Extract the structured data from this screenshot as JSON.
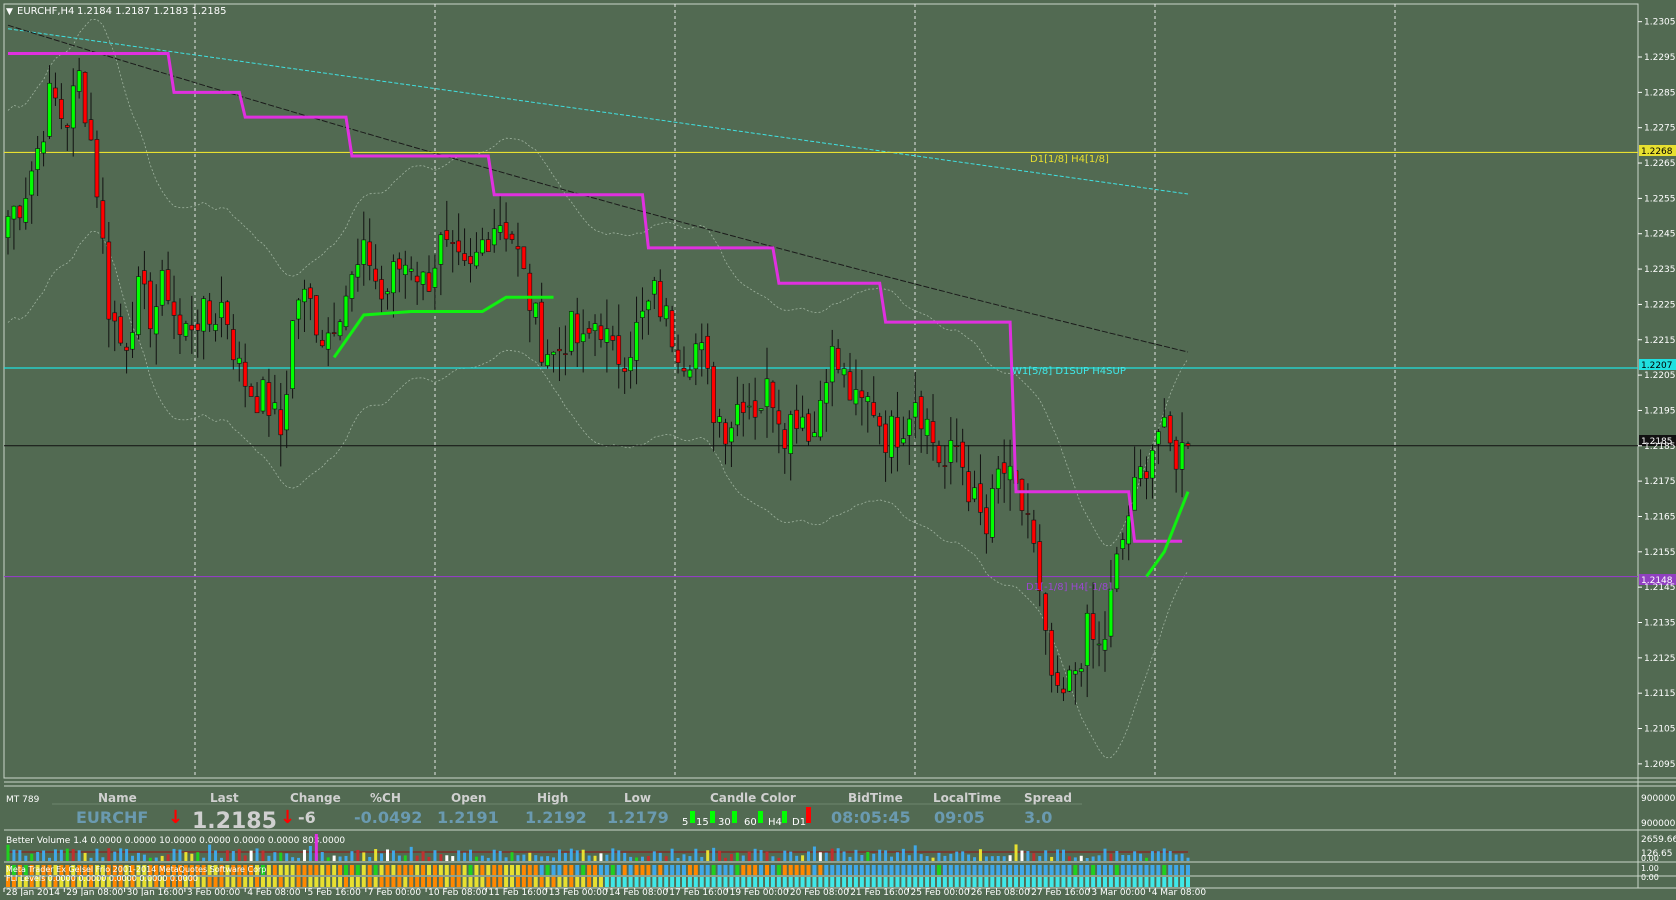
{
  "chart_header": {
    "symbol_tf": "EURCHF,H4",
    "ohlc": "1.2184 1.2187 1.2183 1.2185"
  },
  "colors": {
    "background": "#526a52",
    "bull": "#00ff00",
    "bear": "#ff0000",
    "magenta": "#e030e0",
    "green_line": "#10f010",
    "cyan": "#20e0e0",
    "yellow": "#e8e030",
    "purple": "#9040c0"
  },
  "price_axis": {
    "ticks": [
      "1.2305",
      "1.2295",
      "1.2285",
      "1.2275",
      "1.2265",
      "1.2255",
      "1.2245",
      "1.2235",
      "1.2225",
      "1.2215",
      "1.2205",
      "1.2195",
      "1.2185",
      "1.2175",
      "1.2165",
      "1.2155",
      "1.2145",
      "1.2135",
      "1.2125",
      "1.2115",
      "1.2105",
      "1.2095"
    ],
    "tag_yellow": "1.2268",
    "tag_cyan": "1.2207",
    "tag_black": "1.2185",
    "tag_purple": "1.2148"
  },
  "level_labels": {
    "yellow": "D1[1/8] H4[1/8]",
    "cyan": "W1[5/8] D1SUP H4SUP",
    "purple": "D1[-1/8] H4[-1/8]"
  },
  "time_axis": [
    "28 Jan 2014",
    "29 Jan 08:00",
    "30 Jan 16:00",
    "3 Feb 00:00",
    "4 Feb 08:00",
    "5 Feb 16:00",
    "7 Feb 00:00",
    "10 Feb 08:00",
    "11 Feb 16:00",
    "13 Feb 00:00",
    "14 Feb 08:00",
    "17 Feb 16:00",
    "19 Feb 00:00",
    "20 Feb 08:00",
    "21 Feb 16:00",
    "25 Feb 00:00",
    "26 Feb 08:00",
    "27 Feb 16:00",
    "3 Mar 00:00",
    "4 Mar 08:00"
  ],
  "info_panel": {
    "id": "MT 789",
    "headers": {
      "name": "Name",
      "last": "Last",
      "change": "Change",
      "pct": "%CH",
      "open": "Open",
      "high": "High",
      "low": "Low",
      "candle_color": "Candle Color",
      "bidtime": "BidTime",
      "localtime": "LocalTime",
      "spread": "Spread"
    },
    "values": {
      "name": "EURCHF",
      "last": "1.2185",
      "change": "-6",
      "pct": "-0.0492",
      "open": "1.2191",
      "high": "1.2192",
      "low": "1.2179",
      "bidtime": "08:05:45",
      "localtime": "09:05",
      "spread": "3.0"
    },
    "tf_labels": [
      "5",
      "15",
      "30",
      "60",
      "H4",
      "D1"
    ],
    "axis_top": "9000000",
    "axis_bottom": "9000000"
  },
  "volume_panel": {
    "label": "Better Volume 1.4 0.0000 0.0000 10.0000 0.0000 0.0000 0.0000 803.0000",
    "ticks": [
      "2659.66",
      "126.65",
      "0.00"
    ]
  },
  "bottom_strip": {
    "label1": "Meta Trader Ex Gelsel Frio 2001-2014 MetaQuotes Software Corp",
    "label2": "FLI Levels 0.0000 0.0000 0.0000 0.0000 0.0000",
    "ticks": [
      "1.00",
      "0.00"
    ]
  },
  "chart_data": {
    "type": "candlestick",
    "symbol": "EURCHF",
    "timeframe": "H4",
    "ylim": [
      1.2091,
      1.231
    ],
    "period_first": "28 Jan 2014",
    "period_last": "4 Mar 08:00",
    "last_price": 1.2185,
    "levels": [
      {
        "label": "D1[1/8] H4[1/8]",
        "value": 1.2268
      },
      {
        "label": "W1[5/8] D1SUP H4SUP",
        "value": 1.2207
      },
      {
        "label": "D1[-1/8] H4[-1/8]",
        "value": 1.2148
      }
    ],
    "path_anchors": [
      1.225,
      1.2255,
      1.2268,
      1.2285,
      1.2276,
      1.229,
      1.2266,
      1.2225,
      1.2212,
      1.2228,
      1.2222,
      1.2232,
      1.2215,
      1.2222,
      1.222,
      1.2226,
      1.2207,
      1.22,
      1.2198,
      1.2188,
      1.2228,
      1.2225,
      1.2215,
      1.2225,
      1.2232,
      1.224,
      1.2226,
      1.2235,
      1.2238,
      1.223,
      1.2242,
      1.2236,
      1.2232,
      1.2243,
      1.225,
      1.2245,
      1.223,
      1.2215,
      1.221,
      1.2218,
      1.2212,
      1.2222,
      1.221,
      1.2212,
      1.222,
      1.2228,
      1.2218,
      1.2211,
      1.2214,
      1.2196,
      1.219,
      1.22,
      1.2196,
      1.2202,
      1.219,
      1.2196,
      1.2188,
      1.2212,
      1.2205,
      1.2195,
      1.2198,
      1.2188,
      1.219,
      1.22,
      1.219,
      1.2178,
      1.2185,
      1.217,
      1.216,
      1.218,
      1.217,
      1.2165,
      1.213,
      1.211,
      1.212,
      1.2132,
      1.2126,
      1.215,
      1.2168,
      1.218,
      1.219,
      1.2182,
      1.2185
    ]
  }
}
